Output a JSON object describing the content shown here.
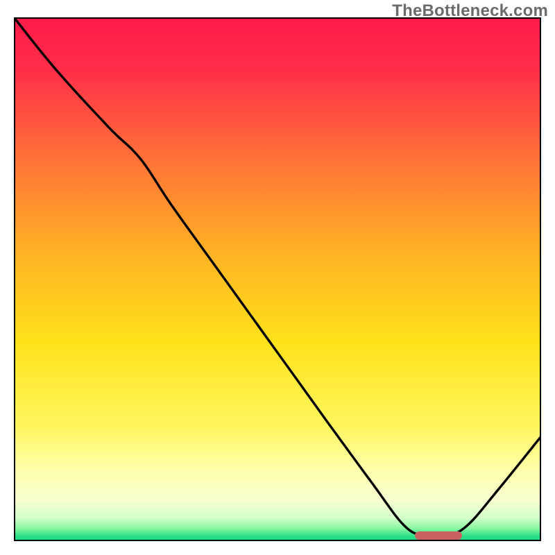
{
  "watermark": "TheBottleneck.com",
  "colors": {
    "gradient_stops": [
      {
        "pos": 0.0,
        "color": "#ff1a4a"
      },
      {
        "pos": 0.1,
        "color": "#ff2e49"
      },
      {
        "pos": 0.25,
        "color": "#ff6a3a"
      },
      {
        "pos": 0.45,
        "color": "#ffb224"
      },
      {
        "pos": 0.62,
        "color": "#ffe21a"
      },
      {
        "pos": 0.78,
        "color": "#fff65e"
      },
      {
        "pos": 0.86,
        "color": "#ffffa8"
      },
      {
        "pos": 0.92,
        "color": "#f8ffd0"
      },
      {
        "pos": 0.955,
        "color": "#d6ffcb"
      },
      {
        "pos": 0.975,
        "color": "#8cf7a2"
      },
      {
        "pos": 0.99,
        "color": "#2fe08a"
      },
      {
        "pos": 1.0,
        "color": "#18d883"
      }
    ],
    "curve": "#000000",
    "marker": "#c9635f",
    "border": "#000000"
  },
  "chart_data": {
    "type": "line",
    "title": "",
    "xlabel": "",
    "ylabel": "",
    "xlim": [
      0,
      100
    ],
    "ylim": [
      0,
      100
    ],
    "grid": false,
    "series": [
      {
        "name": "curve",
        "x": [
          0,
          8,
          18,
          24,
          30,
          40,
          50,
          60,
          68,
          74,
          78,
          82,
          86,
          92,
          100
        ],
        "y": [
          100,
          90,
          79,
          73,
          64,
          50,
          36,
          22,
          11,
          3,
          1,
          1,
          3,
          10,
          20
        ]
      }
    ],
    "target_marker": {
      "x_start": 76,
      "x_end": 85,
      "y": 1
    },
    "description": "Smooth curve descending from top-left, with a gentle inflection near x≈22, reaching a flat minimum around x≈78–84, then rising toward the right edge. Background is a vertical red→orange→yellow→pale→green gradient."
  }
}
